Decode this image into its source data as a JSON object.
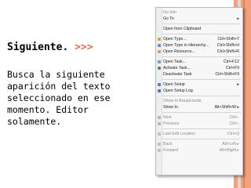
{
  "slide": {
    "heading": "Siguiente.",
    "arrows": ">>>",
    "description_lines": [
      "Busca la siguiente",
      "aparición del texto",
      "seleccionado en ese",
      "momento. Editor",
      "solamente."
    ]
  },
  "menu": {
    "items": [
      {
        "label": "Go Into",
        "shortcut": ""
      },
      {
        "label": "Go To",
        "shortcut": "▸"
      },
      {
        "label": "Open from Clipboard",
        "shortcut": ""
      },
      {
        "label": "Open Type...",
        "shortcut": "Ctrl+Shift+T"
      },
      {
        "label": "Open Type in Hierarchy...",
        "shortcut": "Ctrl+Shift+H"
      },
      {
        "label": "Open Resource...",
        "shortcut": "Ctrl+Shift+R"
      },
      {
        "label": "Open Task...",
        "shortcut": "Ctrl+F12"
      },
      {
        "label": "Activate Task...",
        "shortcut": "Ctrl+F9"
      },
      {
        "label": "Deactivate Task",
        "shortcut": "Ctrl+Shift+F9"
      },
      {
        "label": "Open Setup",
        "shortcut": "▸"
      },
      {
        "label": "Open Setup Log",
        "shortcut": ""
      },
      {
        "label": "Show In Breadcrumb",
        "shortcut": ""
      },
      {
        "label": "Show In",
        "shortcut": "Alt+Shift+W ▸"
      },
      {
        "label": "Next",
        "shortcut": "Ctrl+."
      },
      {
        "label": "Previous",
        "shortcut": "Ctrl+,"
      },
      {
        "label": "Last Edit Location",
        "shortcut": "Ctrl+Q"
      },
      {
        "label": "Back",
        "shortcut": "Alt+Left ▸"
      },
      {
        "label": "Forward",
        "shortcut": "Alt+Right ▸"
      }
    ]
  }
}
